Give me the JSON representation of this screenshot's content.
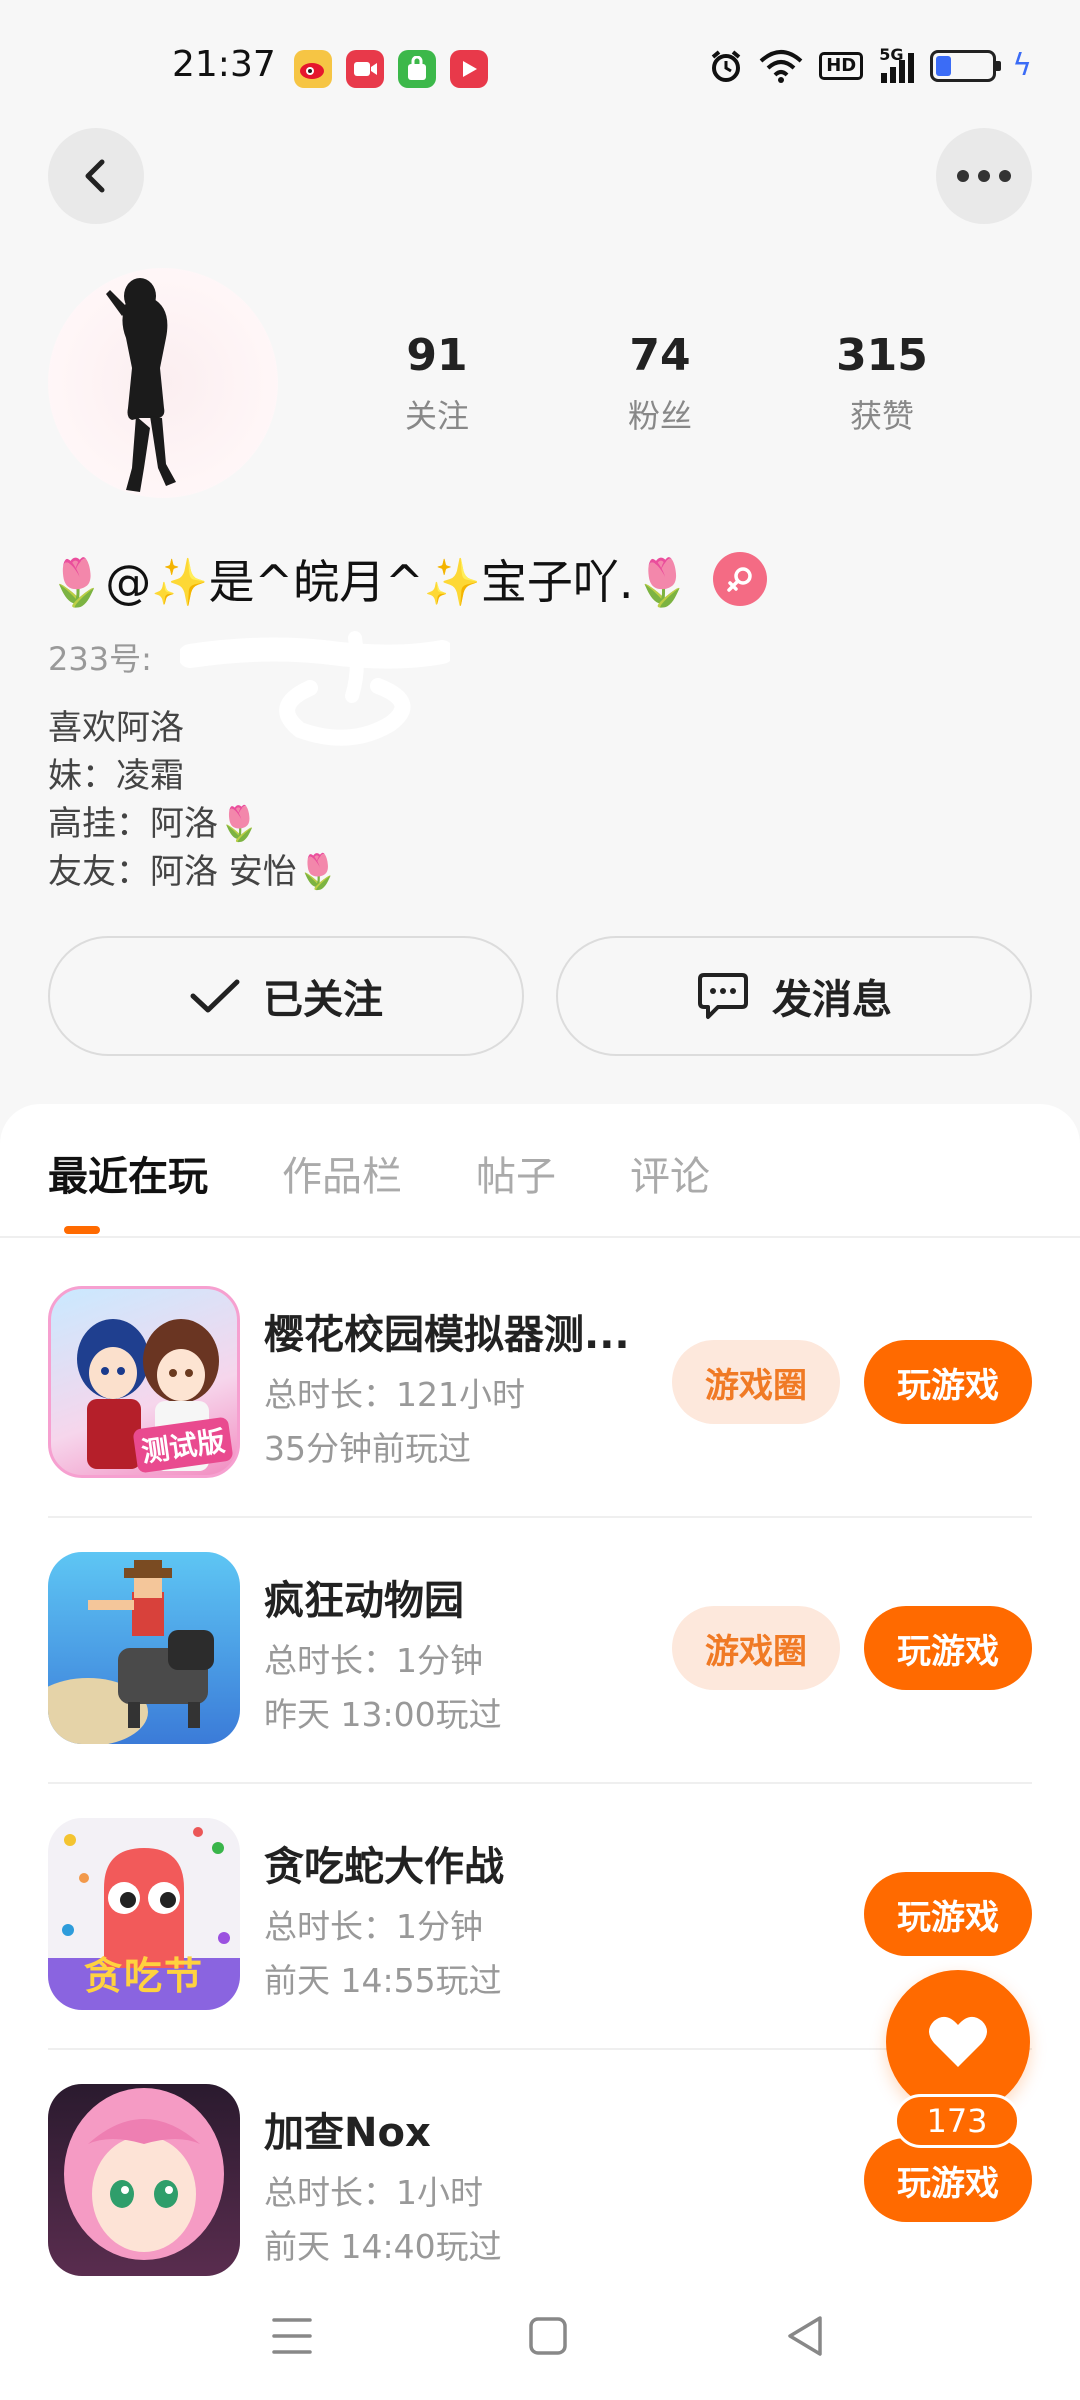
{
  "status_bar": {
    "time": "21:37",
    "network": "5G",
    "hd_label": "HD",
    "battery_level": 0.28,
    "icons": [
      "weibo-icon",
      "video-app-icon",
      "shopping-bag-icon",
      "video-play-icon",
      "alarm-icon",
      "wifi-icon",
      "signal-icon",
      "battery-icon",
      "charging-icon"
    ]
  },
  "header": {
    "back_icon": "chevron-left-icon",
    "more_icon": "more-dots-icon"
  },
  "profile": {
    "stats": [
      {
        "value": "91",
        "label": "关注"
      },
      {
        "value": "74",
        "label": "粉丝"
      },
      {
        "value": "315",
        "label": "获赞"
      }
    ],
    "name": "🌷@✨是^皖月^✨宝子吖.🌷",
    "gender_icon": "female-icon",
    "uid_label": "233号:",
    "bio": [
      "喜欢阿洛",
      "妹：凌霜",
      "高挂：阿洛🌷",
      "友友：阿洛  安怡🌷"
    ]
  },
  "actions": {
    "follow_label": "已关注",
    "message_label": "发消息"
  },
  "tabs": [
    {
      "label": "最近在玩",
      "active": true
    },
    {
      "label": "作品栏",
      "active": false
    },
    {
      "label": "帖子",
      "active": false
    },
    {
      "label": "评论",
      "active": false
    }
  ],
  "games": [
    {
      "title": "樱花校园模拟器测...",
      "duration": "总时长：121小时",
      "last_played": "35分钟前玩过",
      "circle_label": "游戏圈",
      "play_label": "玩游戏",
      "icon_badge": "测试版"
    },
    {
      "title": "疯狂动物园",
      "duration": "总时长：1分钟",
      "last_played": "昨天 13:00玩过",
      "circle_label": "游戏圈",
      "play_label": "玩游戏"
    },
    {
      "title": "贪吃蛇大作战",
      "duration": "总时长：1分钟",
      "last_played": "前天 14:55玩过",
      "play_label": "玩游戏",
      "icon_badge": "贪吃节"
    },
    {
      "title": "加查Nox",
      "duration": "总时长：1小时",
      "last_played": "前天 14:40玩过",
      "play_label": "玩游戏"
    }
  ],
  "like_fab": {
    "count": "173",
    "icon": "heart-icon"
  },
  "colors": {
    "accent": "#ff6a00",
    "accent_soft": "#fde8dc",
    "gender_pink": "#f46b84"
  },
  "nav": {
    "icons": [
      "menu-icon",
      "home-square-icon",
      "back-triangle-icon"
    ]
  }
}
